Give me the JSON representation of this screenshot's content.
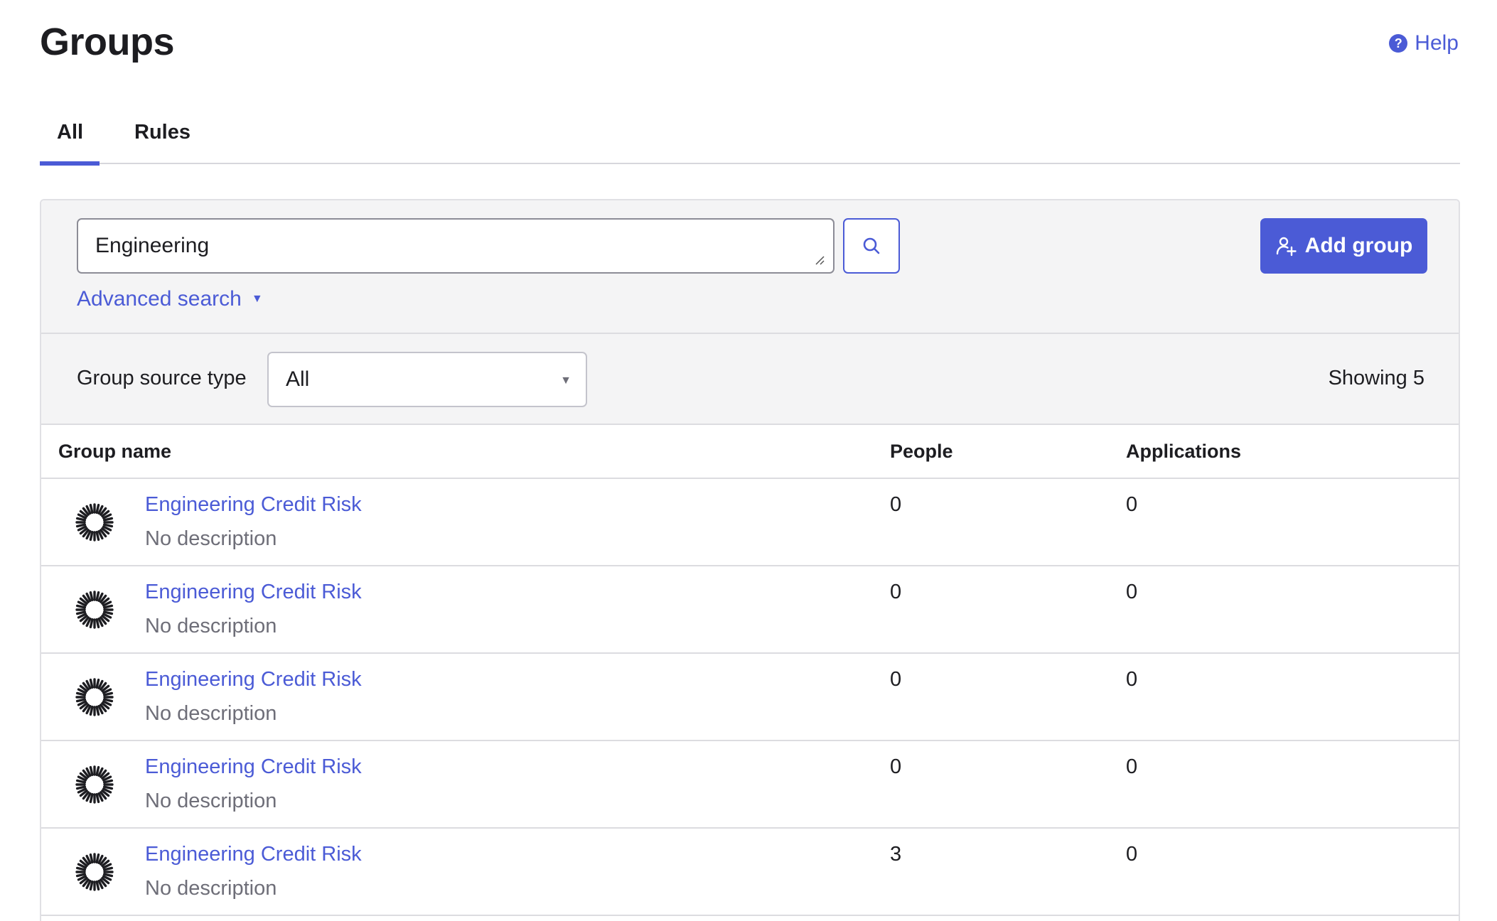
{
  "header": {
    "title": "Groups",
    "help_label": "Help",
    "help_icon": "question-circle-icon"
  },
  "tabs": [
    {
      "label": "All",
      "active": true
    },
    {
      "label": "Rules",
      "active": false
    }
  ],
  "search": {
    "value": "Engineering",
    "search_icon": "search-icon",
    "advanced_label": "Advanced search",
    "add_group_label": "Add group",
    "add_group_icon": "add-user-icon"
  },
  "filter": {
    "label": "Group source type",
    "selected": "All",
    "showing": "Showing 5"
  },
  "table": {
    "columns": {
      "name": "Group name",
      "people": "People",
      "applications": "Applications"
    },
    "rows": [
      {
        "name": "Engineering Credit Risk",
        "description": "No description",
        "people": "0",
        "applications": "0"
      },
      {
        "name": "Engineering Credit Risk",
        "description": "No description",
        "people": "0",
        "applications": "0"
      },
      {
        "name": "Engineering Credit Risk",
        "description": "No description",
        "people": "0",
        "applications": "0"
      },
      {
        "name": "Engineering Credit Risk",
        "description": "No description",
        "people": "0",
        "applications": "0"
      },
      {
        "name": "Engineering Credit Risk",
        "description": "No description",
        "people": "3",
        "applications": "0"
      }
    ]
  },
  "colors": {
    "accent": "#4b5bd6",
    "text": "#1d1d21",
    "muted": "#6e6e78",
    "panel_bg": "#f4f4f5"
  }
}
